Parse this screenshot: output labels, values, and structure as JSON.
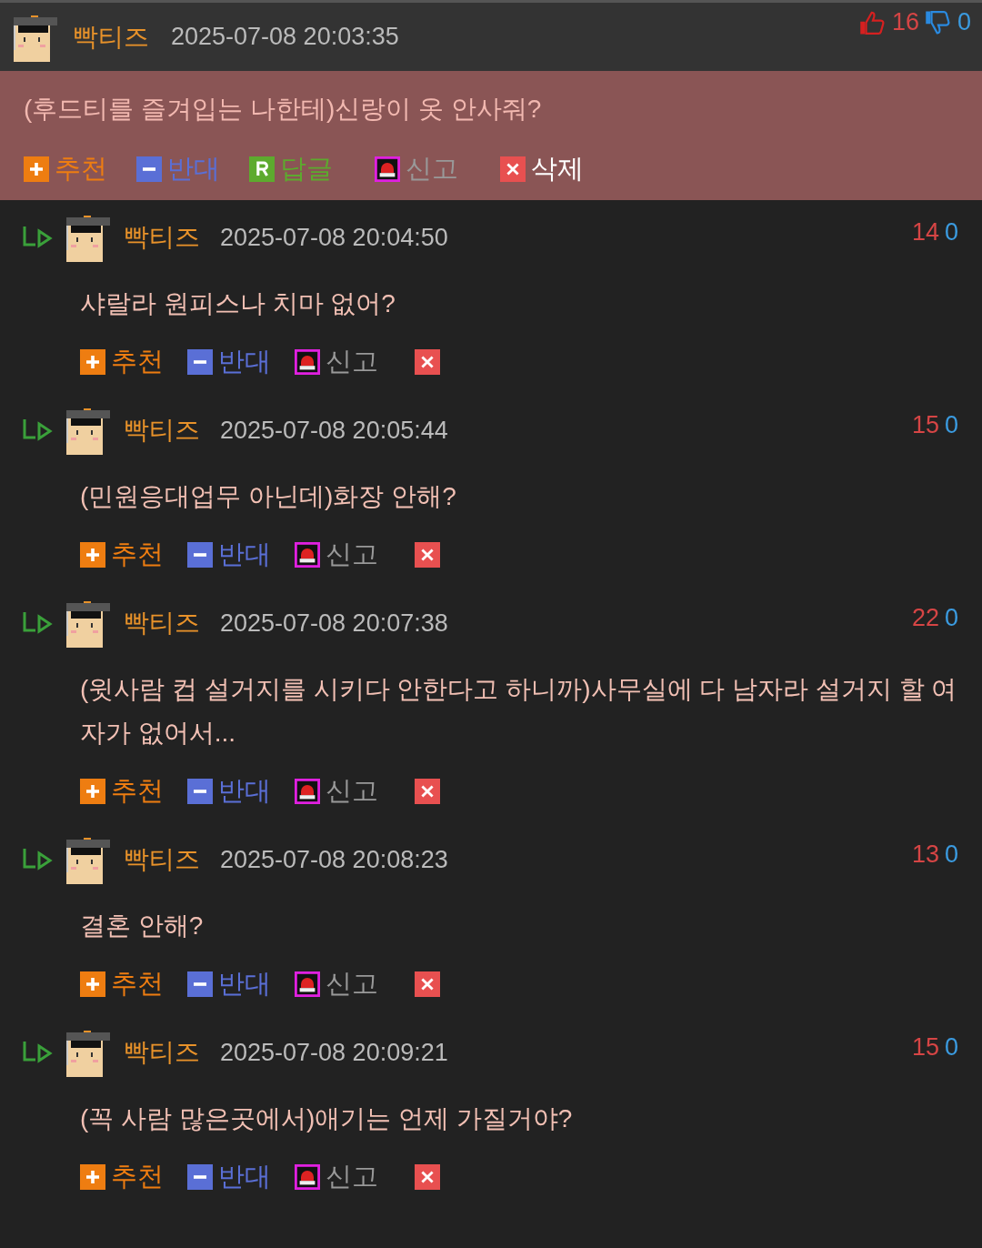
{
  "post": {
    "author": "빡티즈",
    "time": "2025-07-08 20:03:35",
    "likes": "16",
    "dislikes": "0",
    "text": "(후드티를 즐겨입는 나한테)신랑이 옷 안사줘?",
    "actions": [
      {
        "kind": "recommend",
        "label": "추천"
      },
      {
        "kind": "oppose",
        "label": "반대"
      },
      {
        "kind": "reply",
        "label": "답글"
      },
      {
        "kind": "report",
        "label": "신고"
      },
      {
        "kind": "delete",
        "label": "삭제"
      }
    ]
  },
  "replies": [
    {
      "author": "빡티즈",
      "time": "2025-07-08 20:04:50",
      "likes": "14",
      "dislikes": "0",
      "text": "샤랄라 원피스나 치마 없어?",
      "actions": [
        {
          "kind": "recommend",
          "label": "추천"
        },
        {
          "kind": "oppose",
          "label": "반대"
        },
        {
          "kind": "report",
          "label": "신고"
        },
        {
          "kind": "delete"
        }
      ]
    },
    {
      "author": "빡티즈",
      "time": "2025-07-08 20:05:44",
      "likes": "15",
      "dislikes": "0",
      "text": "(민원응대업무 아닌데)화장 안해?",
      "actions": [
        {
          "kind": "recommend",
          "label": "추천"
        },
        {
          "kind": "oppose",
          "label": "반대"
        },
        {
          "kind": "report",
          "label": "신고"
        },
        {
          "kind": "delete"
        }
      ]
    },
    {
      "author": "빡티즈",
      "time": "2025-07-08 20:07:38",
      "likes": "22",
      "dislikes": "0",
      "text": "(윗사람 컵 설거지를 시키다 안한다고 하니까)사무실에 다 남자라 설거지 할 여자가 없어서...",
      "actions": [
        {
          "kind": "recommend",
          "label": "추천"
        },
        {
          "kind": "oppose",
          "label": "반대"
        },
        {
          "kind": "report",
          "label": "신고"
        },
        {
          "kind": "delete"
        }
      ]
    },
    {
      "author": "빡티즈",
      "time": "2025-07-08 20:08:23",
      "likes": "13",
      "dislikes": "0",
      "text": "결혼 안해?",
      "actions": [
        {
          "kind": "recommend",
          "label": "추천"
        },
        {
          "kind": "oppose",
          "label": "반대"
        },
        {
          "kind": "report",
          "label": "신고"
        },
        {
          "kind": "delete"
        }
      ]
    },
    {
      "author": "빡티즈",
      "time": "2025-07-08 20:09:21",
      "likes": "15",
      "dislikes": "0",
      "text": "(꼭 사람 많은곳에서)애기는 언제 가질거야?",
      "actions": [
        {
          "kind": "recommend",
          "label": "추천"
        },
        {
          "kind": "oppose",
          "label": "반대"
        },
        {
          "kind": "report",
          "label": "신고"
        },
        {
          "kind": "delete"
        }
      ]
    }
  ]
}
